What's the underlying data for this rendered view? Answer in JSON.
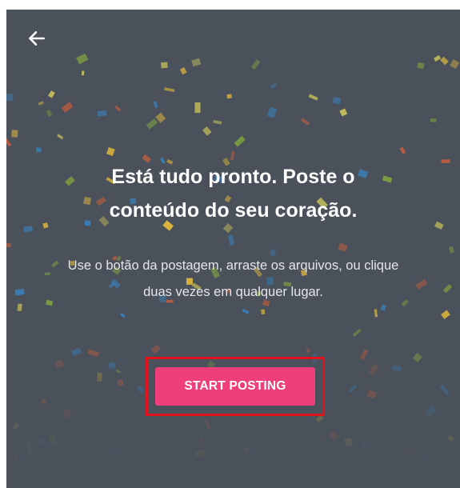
{
  "header": {
    "back_icon": "arrow-left-icon"
  },
  "main": {
    "title": "Está tudo pronto. Poste o conteúdo do seu coração.",
    "subtitle": "Use o botão da postagem, arraste os arquivos, ou clique duas vezes em qualquer lugar.",
    "cta_label": "START POSTING"
  },
  "colors": {
    "background": "#4a515b",
    "cta": "#ee3f7a",
    "highlight": "#e3131b",
    "confetti": [
      "#e2b93b",
      "#3a7fb8",
      "#c25d3e",
      "#7fa33f",
      "#c9c35a"
    ]
  }
}
